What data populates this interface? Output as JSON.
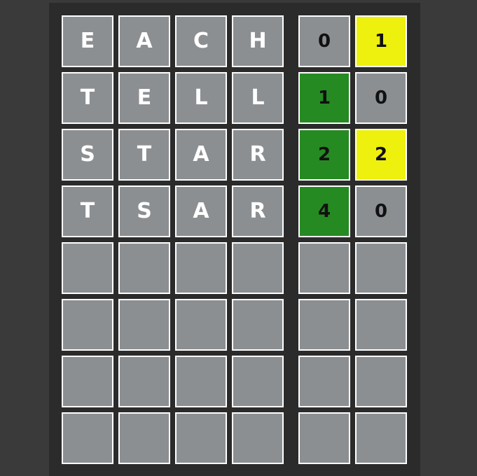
{
  "rows": [
    {
      "letters": [
        "E",
        "A",
        "C",
        "H"
      ],
      "scores": [
        "0",
        "1"
      ]
    },
    {
      "letters": [
        "T",
        "E",
        "L",
        "L"
      ],
      "scores": [
        "1",
        "0"
      ]
    },
    {
      "letters": [
        "S",
        "T",
        "A",
        "R"
      ],
      "scores": [
        "2",
        "2"
      ]
    },
    {
      "letters": [
        "T",
        "S",
        "A",
        "R"
      ],
      "scores": [
        "4",
        "0"
      ]
    },
    {
      "letters": [
        "",
        "",
        "",
        ""
      ],
      "scores": [
        "",
        ""
      ]
    },
    {
      "letters": [
        "",
        "",
        "",
        ""
      ],
      "scores": [
        "",
        ""
      ]
    },
    {
      "letters": [
        "",
        "",
        "",
        ""
      ],
      "scores": [
        "",
        ""
      ]
    },
    {
      "letters": [
        "",
        "",
        "",
        ""
      ],
      "scores": [
        "",
        ""
      ]
    }
  ],
  "colors": {
    "page_background": "#3a3a3a",
    "board_background": "#2b2b2b",
    "tile_gray": "#8c8f92",
    "green": "#268a22",
    "yellow": "#eef00e",
    "tile_border": "#ffffff"
  }
}
